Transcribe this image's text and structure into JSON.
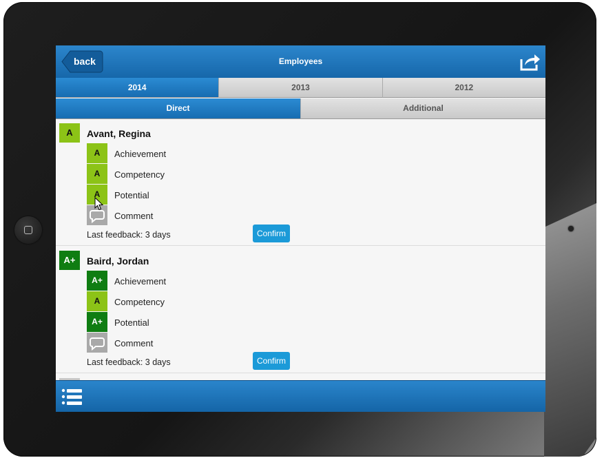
{
  "header": {
    "back_label": "back",
    "title": "Employees",
    "share_icon": "share-icon"
  },
  "year_tabs": [
    {
      "label": "2014",
      "active": true
    },
    {
      "label": "2013",
      "active": false
    },
    {
      "label": "2012",
      "active": false
    }
  ],
  "sub_tabs": [
    {
      "label": "Direct",
      "active": true
    },
    {
      "label": "Additional",
      "active": false
    }
  ],
  "colors": {
    "grade_a": "#8cc317",
    "grade_aplus": "#0f7d12",
    "comment_icon_bg": "#a9a9a9",
    "accent": "#1b9ad8"
  },
  "employees": [
    {
      "grade": "A",
      "name": "Avant, Regina",
      "ratings": [
        {
          "grade": "A",
          "label": "Achievement"
        },
        {
          "grade": "A",
          "label": "Competency"
        },
        {
          "grade": "A",
          "label": "Potential"
        }
      ],
      "comment_label": "Comment",
      "feedback": "Last feedback: 3 days",
      "confirm_label": "Confirm"
    },
    {
      "grade": "A+",
      "name": "Baird, Jordan",
      "ratings": [
        {
          "grade": "A+",
          "label": "Achievement"
        },
        {
          "grade": "A",
          "label": "Competency"
        },
        {
          "grade": "A+",
          "label": "Potential"
        }
      ],
      "comment_label": "Comment",
      "feedback": "Last feedback: 3 days",
      "confirm_label": "Confirm"
    }
  ],
  "footer": {
    "menu_icon": "list-icon"
  }
}
